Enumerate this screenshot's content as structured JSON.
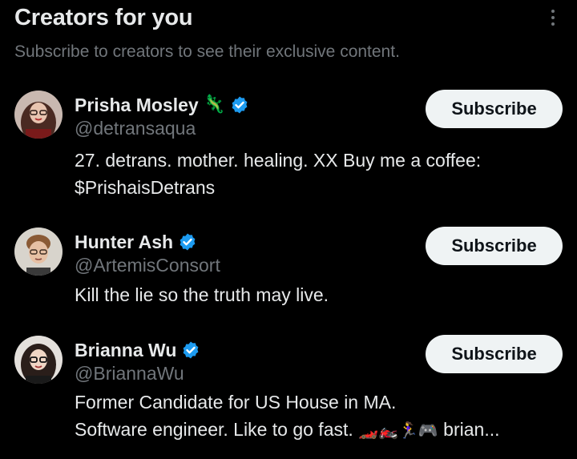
{
  "header": {
    "title": "Creators for you",
    "subtitle": "Subscribe to creators to see their exclusive content."
  },
  "creators": [
    {
      "name": "Prisha Mosley",
      "name_emoji": "🦎",
      "verified": true,
      "handle": "@detransaqua",
      "bio_lines": [
        "27. detrans. mother. healing. XX Buy me a coffee:",
        "$PrishaisDetrans"
      ],
      "subscribe_label": "Subscribe"
    },
    {
      "name": "Hunter Ash",
      "verified": true,
      "handle": "@ArtemisConsort",
      "bio_lines": [
        "Kill the lie so the truth may live."
      ],
      "subscribe_label": "Subscribe"
    },
    {
      "name": "Brianna Wu",
      "verified": true,
      "handle": "@BriannaWu",
      "bio_lines": [
        "Former Candidate for US House in MA."
      ],
      "bio_line2_text": "Software engineer. Like to go fast. ",
      "bio_line2_emojis": "🏎️🏍️🏃‍♀️🎮",
      "bio_line2_tail": " brian...",
      "subscribe_label": "Subscribe"
    }
  ],
  "colors": {
    "background": "#000000",
    "primary_text": "#e7e9ea",
    "secondary_text": "#71767b",
    "verified_badge": "#1d9bf0",
    "button_bg": "#eff3f4",
    "button_text": "#0f1419"
  }
}
